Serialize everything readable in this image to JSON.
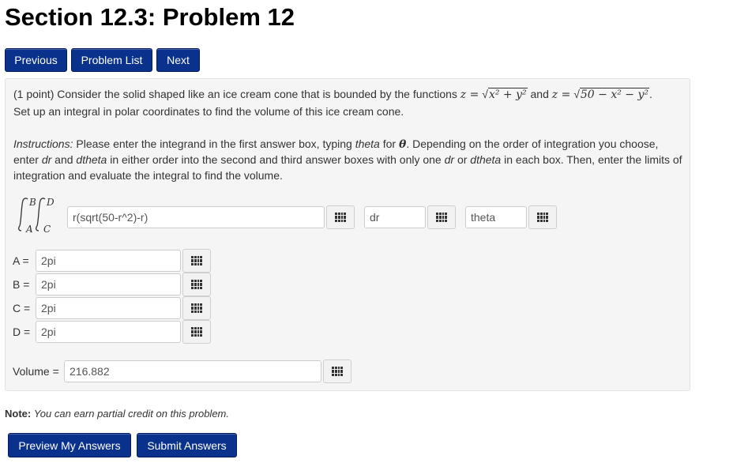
{
  "page": {
    "title": "Section 12.3: Problem 12"
  },
  "nav": {
    "previous": "Previous",
    "problem_list": "Problem List",
    "next": "Next"
  },
  "problem": {
    "intro": "(1 point) Consider the solid shaped like an ice cream cone that is bounded by the functions",
    "eq1_left": "z =",
    "eq1_radicand": "x² + y²",
    "and": "and",
    "eq2_left": "z =",
    "eq2_radicand": "50 − x² − y²",
    "period": ".",
    "line2": "Set up an integral in polar coordinates to find the volume of this ice cream cone.",
    "instr_label": "Instructions:",
    "instr_a": "Please enter the integrand in the first answer box, typing",
    "instr_theta": "theta",
    "instr_b": "for",
    "instr_theta_sym": "θ",
    "instr_c": ". Depending on the order of integration you choose,",
    "instr2_a": "enter",
    "instr2_dr": "dr",
    "instr2_b": "and",
    "instr2_dtheta": "dtheta",
    "instr2_c": "in either order into the second and third answer boxes with only one",
    "instr2_dr2": "dr",
    "instr2_d": "or",
    "instr2_dtheta2": "dtheta",
    "instr2_e": "in each box. Then, enter the limits of",
    "instr3": "integration and evaluate the integral to find the volume.",
    "integral": {
      "upper_outer": "B",
      "lower_outer": "A",
      "upper_inner": "D",
      "lower_inner": "C"
    },
    "answers": {
      "integrand": "r(sqrt(50-r^2)-r)",
      "diff1": "dr",
      "diff2": "theta",
      "A_label": "A =",
      "A": "2pi",
      "B_label": "B =",
      "B": "2pi",
      "C_label": "C =",
      "C": "2pi",
      "D_label": "D =",
      "D": "2pi",
      "volume_label": "Volume =",
      "volume": "216.882"
    }
  },
  "note": {
    "bold": "Note:",
    "text": "You can earn partial credit on this problem."
  },
  "actions": {
    "preview": "Preview My Answers",
    "submit": "Submit Answers"
  },
  "colors": {
    "button": "#0a318c",
    "panel": "#f5f5f5"
  }
}
